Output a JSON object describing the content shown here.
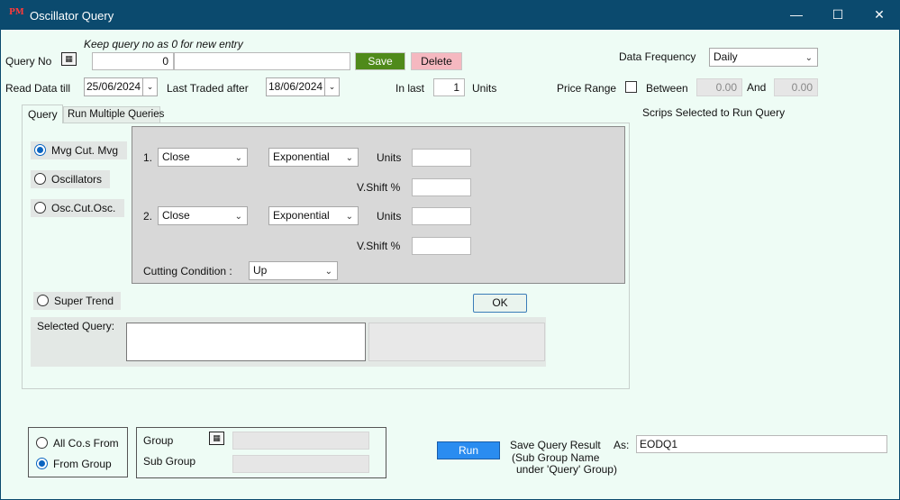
{
  "window": {
    "title": "Oscillator Query",
    "app_icon": "PM",
    "minimize": "—",
    "maximize": "☐",
    "close": "✕"
  },
  "query": {
    "hint": "Keep query no as 0 for new entry",
    "query_no_label": "Query No",
    "query_no_value": "0",
    "query_name_value": "",
    "save_label": "Save",
    "delete_label": "Delete"
  },
  "dates": {
    "read_till_label": "Read Data till",
    "read_till_value": "25/06/2024",
    "last_traded_label": "Last Traded after",
    "last_traded_value": "18/06/2024"
  },
  "in_last": {
    "label": "In last",
    "value": "1",
    "units_label": "Units"
  },
  "data_frequency": {
    "label": "Data Frequency",
    "value": "Daily"
  },
  "price_range": {
    "label": "Price Range",
    "between_label": "Between",
    "between_value": "0.00",
    "and_label": "And",
    "and_value": "0.00"
  },
  "tabs": {
    "query": "Query",
    "run_multiple": "Run Multiple Queries"
  },
  "modes": {
    "mvg_cut_mvg": "Mvg Cut. Mvg",
    "oscillators": "Oscillators",
    "osc_cut_osc": "Osc.Cut.Osc.",
    "super_trend": "Super Trend"
  },
  "params": {
    "row1_num": "1.",
    "row1_field": "Close",
    "row1_type": "Exponential",
    "row2_num": "2.",
    "row2_field": "Close",
    "row2_type": "Exponential",
    "units_label": "Units",
    "vshift_label": "V.Shift %",
    "cutting_label": "Cutting Condition :",
    "cutting_value": "Up",
    "ok_label": "OK"
  },
  "selected_query": {
    "label": "Selected Query:",
    "value": ""
  },
  "scrips": {
    "label": "Scrips Selected to Run Query"
  },
  "scope": {
    "all_cos_label": "All Co.s From",
    "from_group_label": "From Group",
    "group_label": "Group",
    "sub_group_label": "Sub Group"
  },
  "run": {
    "run_label": "Run",
    "save_result_label": "Save Query Result",
    "as_label": "As:",
    "as_value": "EODQ1",
    "note_line1": "(Sub Group Name",
    "note_line2": "under 'Query' Group)"
  },
  "colors": {
    "titlebar": "#0b4a6e",
    "window_bg": "#eefcf5",
    "save_btn": "#4f8a1a",
    "delete_btn": "#f5b8c0",
    "run_btn": "#2a8cf0",
    "ok_btn": "#eaf4ee",
    "param_panel": "#d8d8d8"
  }
}
